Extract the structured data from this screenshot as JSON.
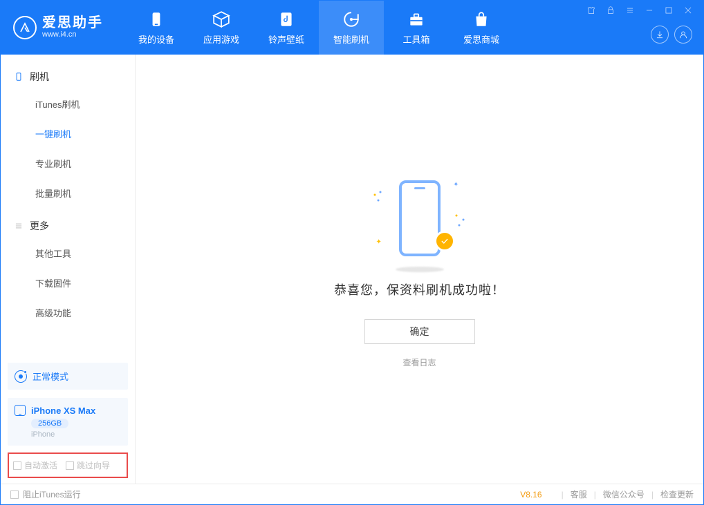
{
  "app": {
    "title": "爱思助手",
    "subtitle": "www.i4.cn"
  },
  "nav": {
    "device": "我的设备",
    "apps": "应用游戏",
    "ring": "铃声壁纸",
    "flash": "智能刷机",
    "toolbox": "工具箱",
    "store": "爱思商城"
  },
  "sidebar": {
    "group_flash": "刷机",
    "itunes_flash": "iTunes刷机",
    "one_click": "一键刷机",
    "pro_flash": "专业刷机",
    "batch_flash": "批量刷机",
    "group_more": "更多",
    "other_tools": "其他工具",
    "download_fw": "下载固件",
    "advanced": "高级功能"
  },
  "status": {
    "mode": "正常模式"
  },
  "device": {
    "name": "iPhone XS Max",
    "storage": "256GB",
    "type": "iPhone"
  },
  "options": {
    "auto_activate": "自动激活",
    "skip_guide": "跳过向导"
  },
  "main": {
    "message": "恭喜您，保资料刷机成功啦！",
    "ok": "确定",
    "view_log": "查看日志"
  },
  "footer": {
    "block_itunes": "阻止iTunes运行",
    "version": "V8.16",
    "cs": "客服",
    "wechat": "微信公众号",
    "update": "检查更新"
  }
}
